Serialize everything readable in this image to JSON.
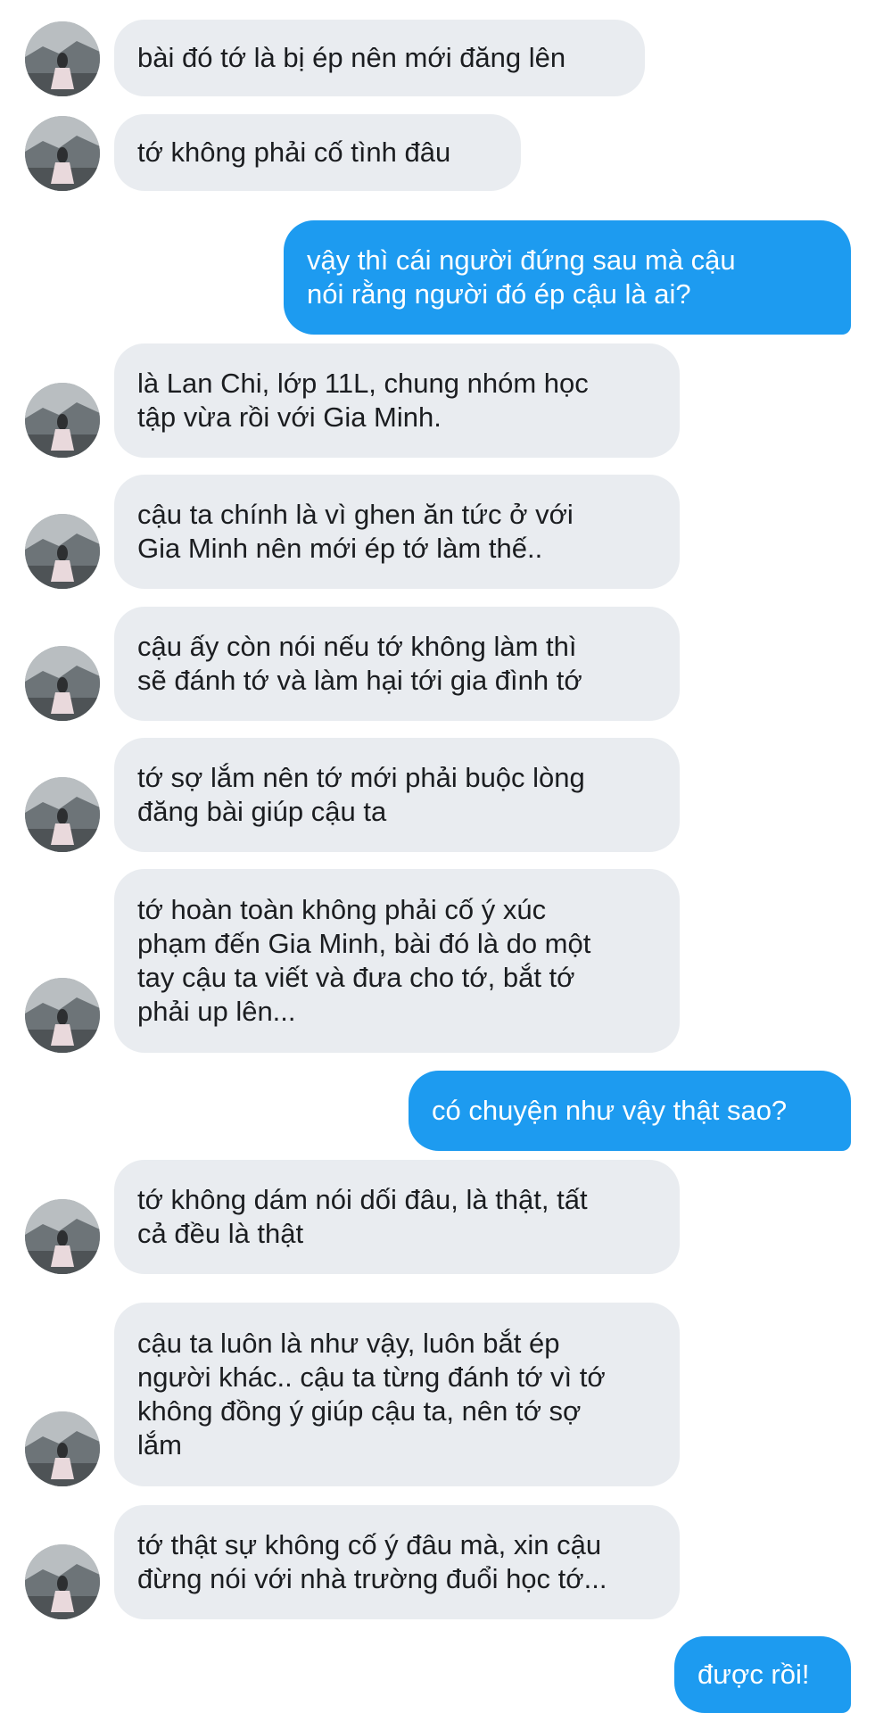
{
  "messages": [
    {
      "side": "in",
      "text": "bài đó tớ là bị ép nên mới đăng lên"
    },
    {
      "side": "in",
      "text": "tớ không phải cố tình đâu"
    },
    {
      "side": "out",
      "text": "vậy thì cái người đứng sau mà cậu\nnói rằng người đó ép cậu là ai?"
    },
    {
      "side": "in",
      "text": "là Lan Chi, lớp 11L, chung nhóm học\ntập vừa rồi với Gia Minh."
    },
    {
      "side": "in",
      "text": "cậu ta chính là vì ghen ăn tức ở với\nGia Minh nên mới ép tớ làm thế.."
    },
    {
      "side": "in",
      "text": "cậu ấy còn nói nếu tớ không làm thì\nsẽ đánh tớ và làm hại tới gia đình tớ"
    },
    {
      "side": "in",
      "text": "tớ sợ lắm nên tớ mới phải buộc lòng\nđăng bài giúp cậu ta"
    },
    {
      "side": "in",
      "text": "tớ hoàn toàn không phải cố ý xúc\nphạm đến Gia Minh, bài đó là do một\ntay cậu ta viết và đưa cho tớ, bắt tớ\nphải up lên..."
    },
    {
      "side": "out",
      "text": "có chuyện như vậy thật sao?"
    },
    {
      "side": "in",
      "text": "tớ không dám nói dối đâu, là thật, tất\ncả đều là thật"
    },
    {
      "side": "in",
      "text": "cậu ta luôn là như vậy, luôn bắt ép\nngười khác.. cậu ta từng đánh tớ vì tớ\nkhông đồng ý giúp cậu ta, nên tớ sợ\nlắm"
    },
    {
      "side": "in",
      "text": "tớ thật sự không cố ý đâu mà, xin cậu\nđừng nói với nhà trường đuổi học tớ..."
    },
    {
      "side": "out",
      "text": "được rồi!"
    }
  ]
}
